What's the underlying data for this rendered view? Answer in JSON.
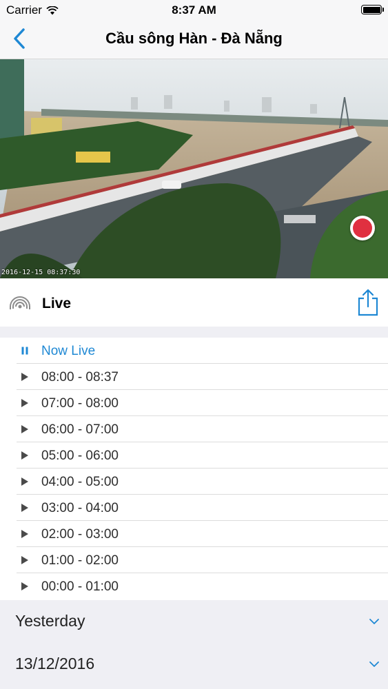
{
  "status_bar": {
    "carrier": "Carrier",
    "time": "8:37 AM"
  },
  "nav": {
    "title": "Cầu sông Hàn - Đà Nẵng"
  },
  "camera": {
    "timestamp": "2016-12-15 08:37:30"
  },
  "live": {
    "label": "Live"
  },
  "playlist": {
    "now_live": "Now Live",
    "items": [
      "08:00 - 08:37",
      "07:00 - 08:00",
      "06:00 - 07:00",
      "05:00 - 06:00",
      "04:00 - 05:00",
      "03:00 - 04:00",
      "02:00 - 03:00",
      "01:00 - 02:00",
      "00:00 - 01:00"
    ]
  },
  "sections": [
    {
      "label": "Yesterday"
    },
    {
      "label": "13/12/2016"
    }
  ],
  "colors": {
    "accent": "#1e88d4",
    "record": "#e03040",
    "group_background": "#efeff4"
  }
}
